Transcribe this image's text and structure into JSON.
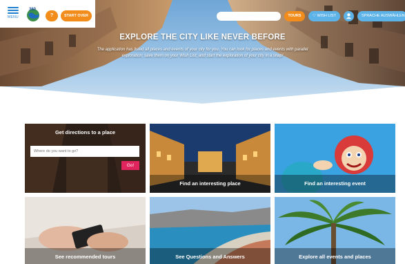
{
  "header": {
    "menu_label": "MENU",
    "logo_text": "360",
    "help_label": "?",
    "start_over_label": "START OVER",
    "search": {
      "value": "",
      "placeholder": ""
    },
    "tours_label": "TOURS",
    "wish_list_label": "♡ WISH LIST",
    "language_label": "SPRACHE AUSWÄHLEN"
  },
  "hero": {
    "title": "EXPLORE THE CITY LIKE NEVER BEFORE",
    "subtitle": "The application has listed all places and events of your city for you. You can look for places and events with parallel exploration; save them on your Wish List; and start the exploration of your city in a snap!"
  },
  "tiles": [
    {
      "title": "Get directions to a place",
      "input_placeholder": "Where do you want to go?",
      "button_label": "Go!"
    },
    {
      "label": "Find an interesting place"
    },
    {
      "label": "Find an interesting event"
    },
    {
      "label": "See recommended tours"
    },
    {
      "label": "See Questions and Answers"
    },
    {
      "label": "Explore all events and places"
    }
  ],
  "colors": {
    "orange": "#f28c1a",
    "light_blue": "#5db3e8",
    "menu_blue": "#1e7fd1",
    "go_pink": "#e0245e"
  },
  "icons": [
    "menu-icon",
    "logo-globe-icon",
    "heart-icon",
    "user-icon"
  ]
}
